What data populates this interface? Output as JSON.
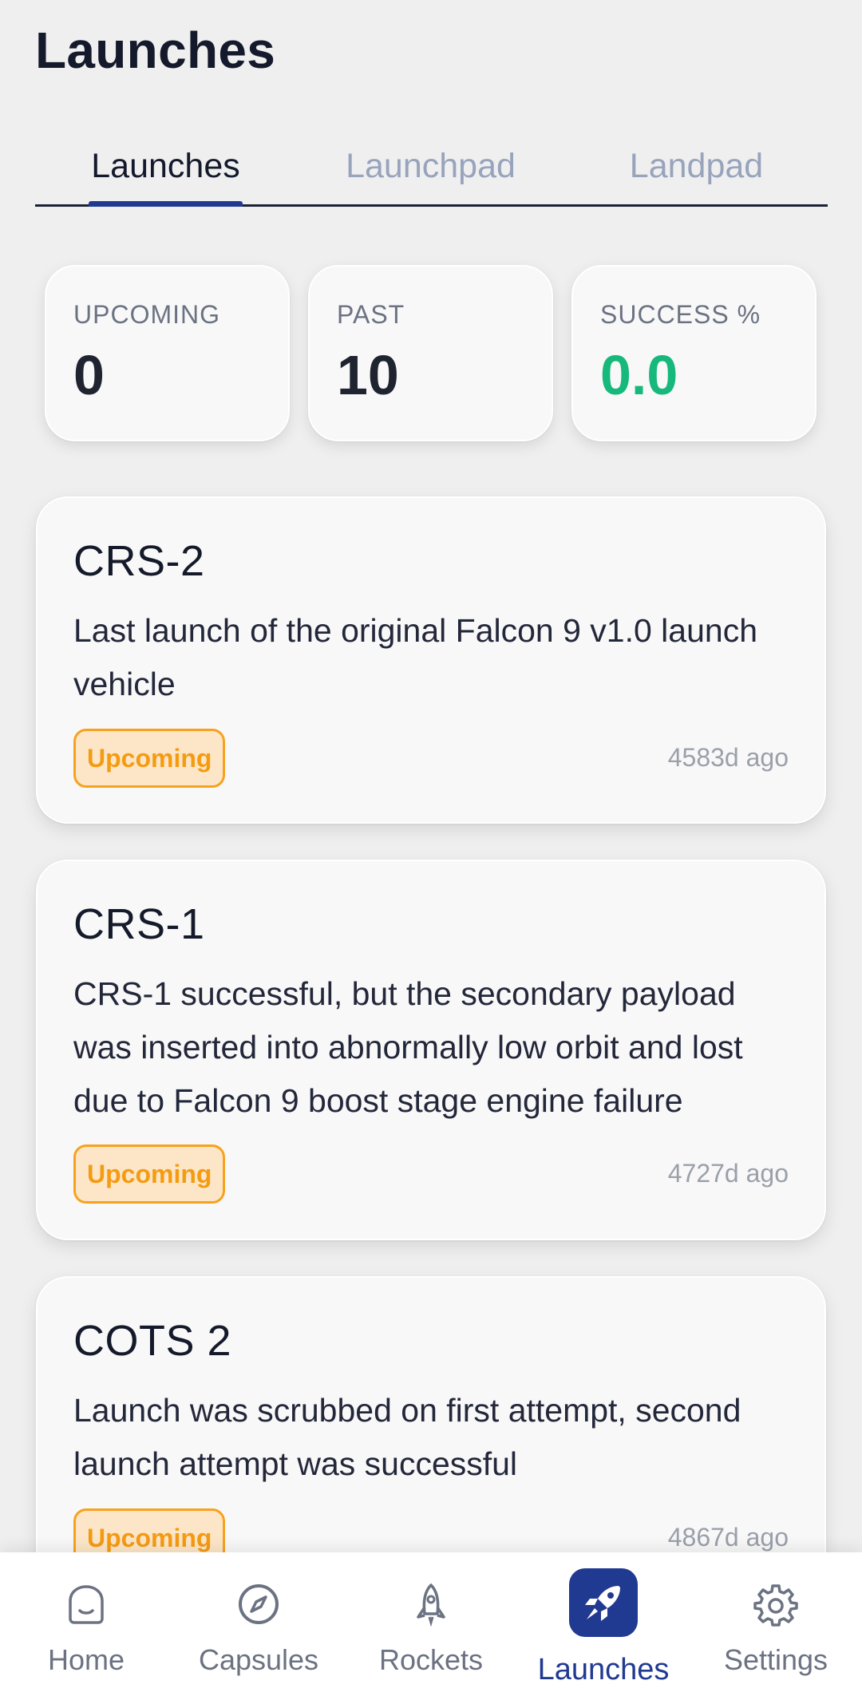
{
  "header": {
    "title": "Launches"
  },
  "tabs": [
    {
      "label": "Launches",
      "active": true
    },
    {
      "label": "Launchpad",
      "active": false
    },
    {
      "label": "Landpad",
      "active": false
    }
  ],
  "stats": [
    {
      "label": "UPCOMING",
      "value": "0"
    },
    {
      "label": "PAST",
      "value": "10"
    },
    {
      "label": "SUCCESS %",
      "value": "0.0"
    }
  ],
  "launches": [
    {
      "title": "CRS-2",
      "description": "Last launch of the original Falcon 9 v1.0 launch vehicle",
      "status": "Upcoming",
      "ago": "4583d ago"
    },
    {
      "title": "CRS-1",
      "description": "CRS-1 successful, but the secondary payload was inserted into abnormally low orbit and lost due to Falcon 9 boost stage engine failure",
      "status": "Upcoming",
      "ago": "4727d ago"
    },
    {
      "title": "COTS 2",
      "description": "Launch was scrubbed on first attempt, second launch attempt was successful",
      "status": "Upcoming",
      "ago": "4867d ago"
    }
  ],
  "nav": [
    {
      "label": "Home",
      "icon": "home-icon",
      "active": false
    },
    {
      "label": "Capsules",
      "icon": "compass-icon",
      "active": false
    },
    {
      "label": "Rockets",
      "icon": "rocket-icon",
      "active": false
    },
    {
      "label": "Launches",
      "icon": "launch-rocket-icon",
      "active": true
    },
    {
      "label": "Settings",
      "icon": "gear-icon",
      "active": false
    }
  ],
  "colors": {
    "accent": "#213a91",
    "success": "#16b87b",
    "badge_text": "#f59b12",
    "badge_bg": "#fde6c8"
  }
}
